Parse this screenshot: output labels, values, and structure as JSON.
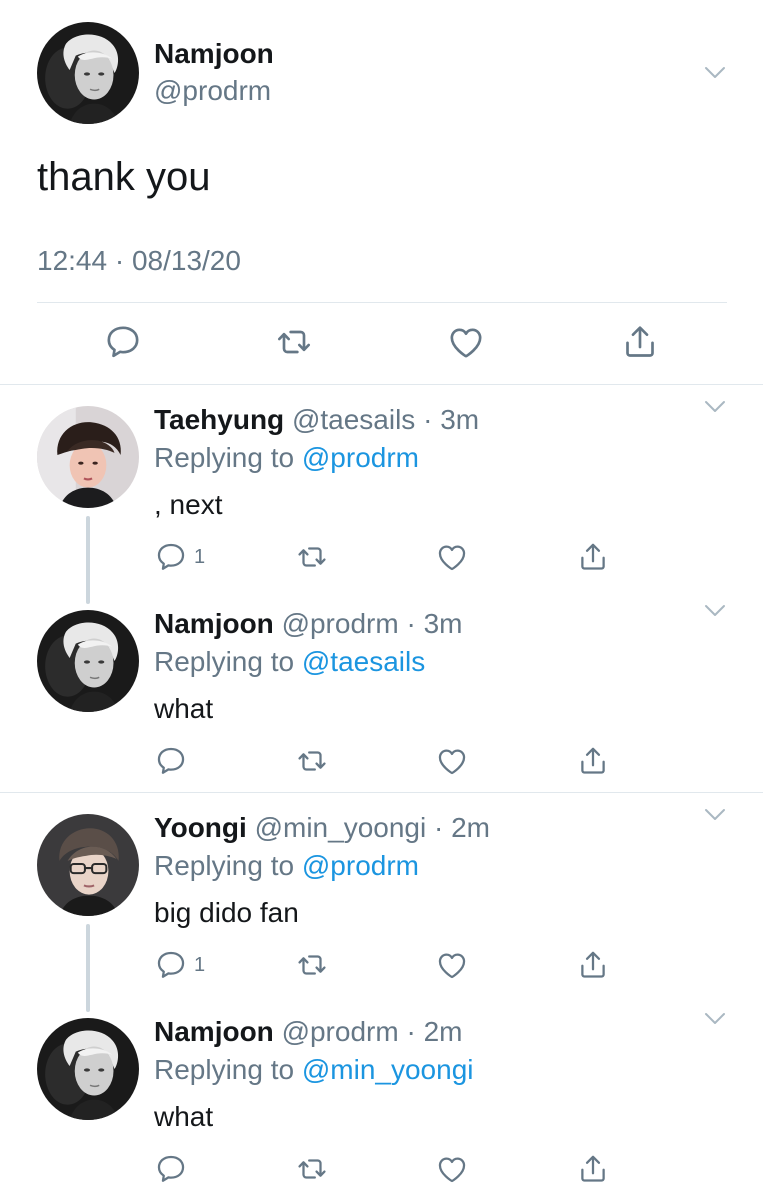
{
  "main_tweet": {
    "name": "Namjoon",
    "handle": "@prodrm",
    "text": "thank you",
    "timestamp": "12:44 · 08/13/20",
    "avatar_icon": "avatar-namjoon",
    "actions": [
      "reply-icon",
      "retweet-icon",
      "like-icon",
      "share-icon"
    ]
  },
  "replies": [
    {
      "name": "Taehyung",
      "handle": "@taesails",
      "dot": "·",
      "time": "3m",
      "replying_prefix": "Replying to",
      "replying_to": "@prodrm",
      "text": ", next",
      "reply_count": "1",
      "avatar_icon": "avatar-taehyung"
    },
    {
      "name": "Namjoon",
      "handle": "@prodrm",
      "dot": "·",
      "time": "3m",
      "replying_prefix": "Replying to",
      "replying_to": "@taesails",
      "text": "what",
      "reply_count": "",
      "avatar_icon": "avatar-namjoon"
    },
    {
      "name": "Yoongi",
      "handle": "@min_yoongi",
      "dot": "·",
      "time": "2m",
      "replying_prefix": "Replying to",
      "replying_to": "@prodrm",
      "text": "big dido fan",
      "reply_count": "1",
      "avatar_icon": "avatar-yoongi"
    },
    {
      "name": "Namjoon",
      "handle": "@prodrm",
      "dot": "·",
      "time": "2m",
      "replying_prefix": "Replying to",
      "replying_to": "@min_yoongi",
      "text": "what",
      "reply_count": "",
      "avatar_icon": "avatar-namjoon"
    }
  ],
  "colors": {
    "primary_text": "#14171a",
    "secondary_text": "#657786",
    "link": "#1b95e0",
    "divider": "#e1e8ed",
    "thread_line": "#ccd6dd"
  }
}
